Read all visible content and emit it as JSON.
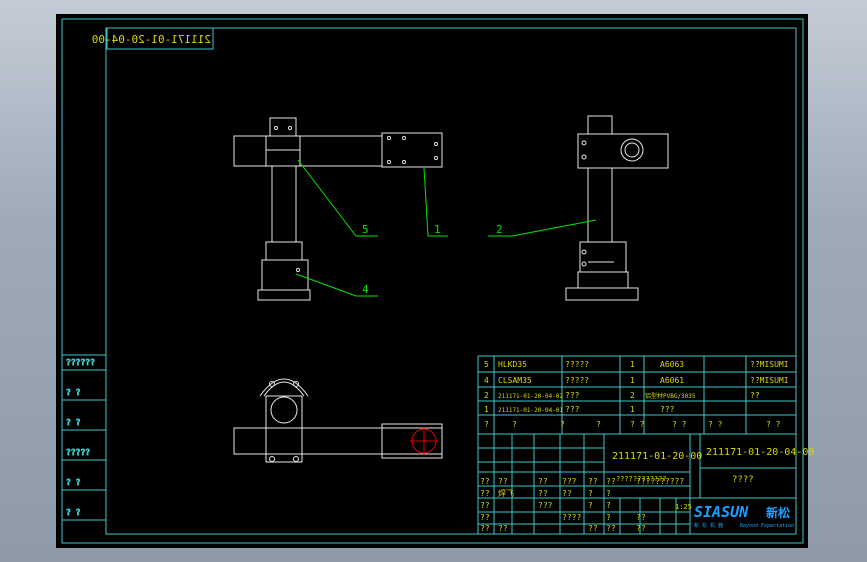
{
  "drawing": {
    "title_block_code": "211171-01-20-04-00",
    "mirrored_code": "211171-01-20-04-00",
    "assembly_ref": "211171-01-20-00",
    "title_small": "????",
    "title_hint": "????????????",
    "scale_label": "1:25",
    "company": {
      "name": "SIASUN",
      "cn": "新松",
      "slogan_cn": "新 松 机 器",
      "slogan_en": "Beyond Expectation"
    },
    "colors": {
      "line": "#00b4b4",
      "part": "#e6e6e6",
      "callout": "#00e600",
      "text": "#d8d800",
      "red": "#e00000",
      "frame": "#3cc8c8"
    }
  },
  "callouts": [
    {
      "label": "5"
    },
    {
      "label": "1"
    },
    {
      "label": "2"
    },
    {
      "label": "4"
    }
  ],
  "left_column": [
    "??????",
    "? ?",
    "? ?",
    "?????",
    "? ?",
    "? ?"
  ],
  "bom": [
    {
      "no": "5",
      "part": "HLKD35",
      "name": "?????",
      "qty": "1",
      "material": "A6063",
      "note": "??MISUMI"
    },
    {
      "no": "4",
      "part": "CLSAM35",
      "name": "?????",
      "qty": "1",
      "material": "A6061",
      "note": "??MISUMI"
    },
    {
      "no": "2",
      "part": "211171-01-20-04-02",
      "name": "???",
      "qty": "2",
      "material": "铝型材PVBG/3035",
      "note": "??"
    },
    {
      "no": "1",
      "part": "211171-01-20-04-01",
      "name": "???",
      "qty": "1",
      "material": "???",
      "note": ""
    }
  ],
  "bom_header": [
    "?",
    "?",
    "?",
    "?",
    "? ?",
    "? ?",
    "? ?",
    "? ?"
  ],
  "title_rows": [
    [
      "??",
      "??",
      "??",
      "???",
      "??",
      "??",
      "??????????"
    ],
    [
      "??",
      "焊飞",
      "??",
      "??",
      "?",
      "?"
    ],
    [
      "??",
      "",
      "???",
      "",
      "?",
      "?"
    ],
    [
      "??",
      "",
      "",
      "????",
      "",
      "?",
      "??"
    ],
    [
      "??",
      "??",
      "",
      "",
      "??",
      "??",
      "??"
    ]
  ]
}
